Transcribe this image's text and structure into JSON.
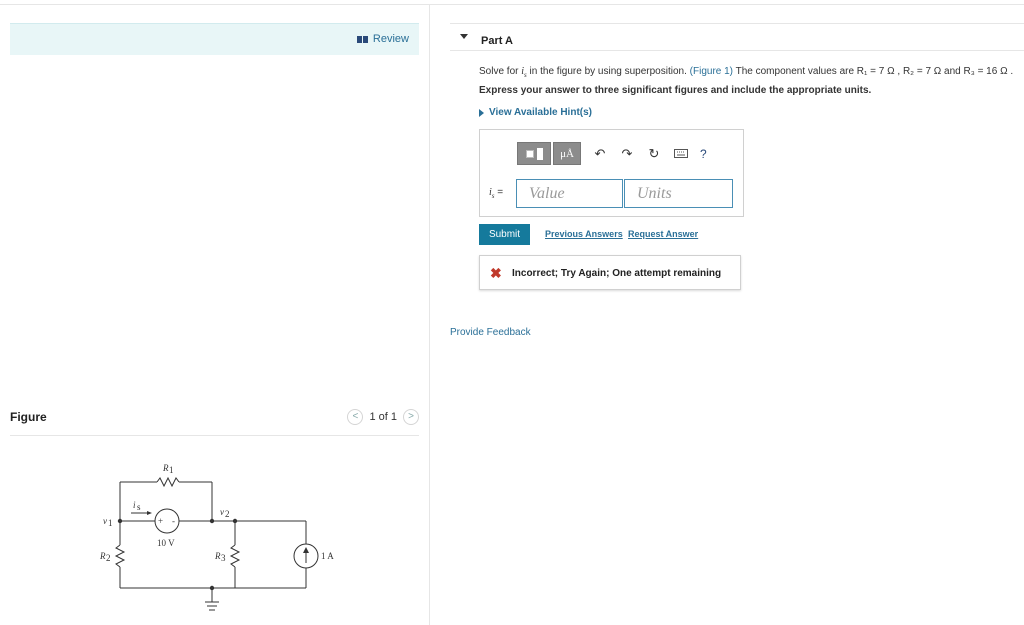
{
  "left_panel": {
    "review_label": "Review",
    "figure_title": "Figure",
    "pager": {
      "prev": "<",
      "count": "1 of 1",
      "next": ">"
    }
  },
  "circuit": {
    "labels": {
      "r1": "R",
      "r1_sub": "1",
      "r2": "R",
      "r2_sub": "2",
      "r3": "R",
      "r3_sub": "3",
      "v1": "v",
      "v1_sub": "1",
      "v2": "v",
      "v2_sub": "2",
      "is": "i",
      "is_sub": "s",
      "plus": "+",
      "minus": "-",
      "voltage_source": "10 V",
      "current_source": "1 A"
    }
  },
  "part": {
    "title": "Part A",
    "question_prefix": "Solve for ",
    "question_var": "i",
    "question_var_sub": "s",
    "question_mid": " in the figure by using superposition. ",
    "figure_link": "(Figure 1)",
    "question_values": " The component values are R₁ = 7 Ω , R₂ = 7 Ω and R₃ = 16 Ω .",
    "instruction": "Express your answer to three significant figures and include the appropriate units.",
    "hints_label": "View Available Hint(s)"
  },
  "answer": {
    "mu_label": "μÅ",
    "help_label": "?",
    "var_label": "i",
    "var_sub": "s",
    "equals": " =",
    "value_placeholder": "Value",
    "units_placeholder": "Units"
  },
  "actions": {
    "submit": "Submit",
    "previous_answers": "Previous Answers",
    "request_answer": "Request Answer"
  },
  "feedback": {
    "icon": "✖",
    "message": "Incorrect; Try Again; One attempt remaining"
  },
  "provide_feedback": "Provide Feedback"
}
